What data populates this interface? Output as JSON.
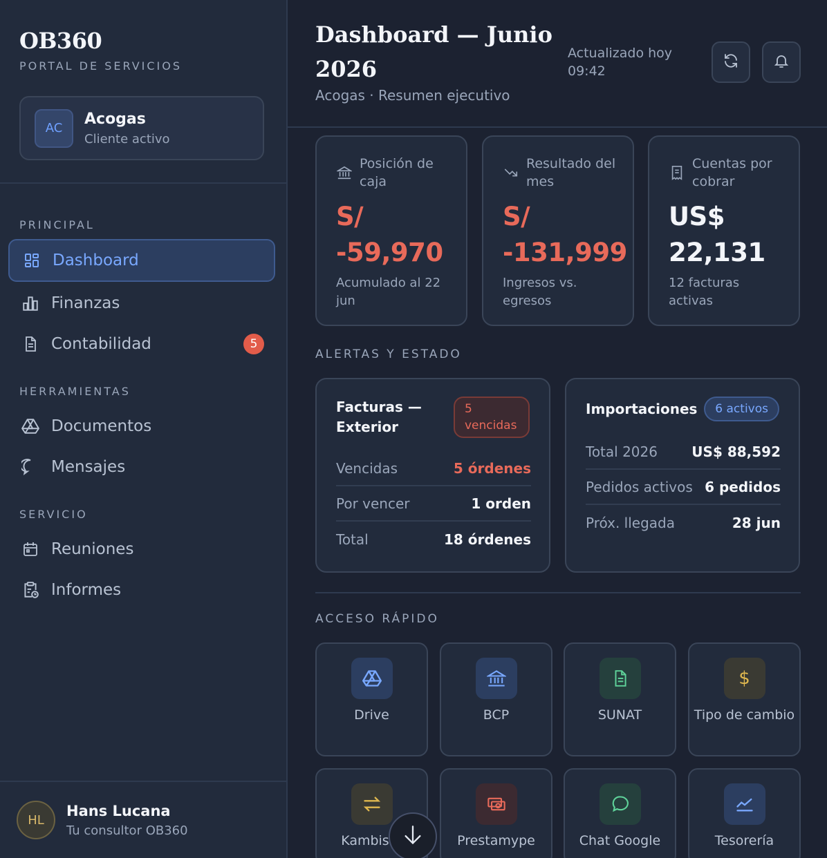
{
  "brand": {
    "title": "OB360",
    "subtitle": "PORTAL DE SERVICIOS"
  },
  "client": {
    "initials": "AC",
    "name": "Acogas",
    "status": "Cliente activo"
  },
  "nav": {
    "principal_label": "PRINCIPAL",
    "herramientas_label": "HERRAMIENTAS",
    "servicio_label": "SERVICIO",
    "items": [
      {
        "label": "Dashboard",
        "icon": "dashboard-icon"
      },
      {
        "label": "Finanzas",
        "icon": "bar-chart-icon"
      },
      {
        "label": "Contabilidad",
        "icon": "document-icon",
        "badge": "5"
      },
      {
        "label": "Documentos",
        "icon": "drive-icon"
      },
      {
        "label": "Mensajes",
        "icon": "chat-icon"
      },
      {
        "label": "Reuniones",
        "icon": "calendar-icon"
      },
      {
        "label": "Informes",
        "icon": "report-icon"
      }
    ]
  },
  "user": {
    "initials": "HL",
    "name": "Hans Lucana",
    "role": "Tu consultor OB360"
  },
  "header": {
    "title": "Dashboard — Junio 2026",
    "subtitle": "Acogas · Resumen ejecutivo",
    "updated": "Actualizado hoy 09:42"
  },
  "kpis": [
    {
      "label": "Posición de caja",
      "value": "S/ -59,970",
      "note": "Acumulado al 22 jun",
      "icon": "bank-icon"
    },
    {
      "label": "Resultado del mes",
      "value": "S/ -131,999",
      "note": "Ingresos vs. egresos",
      "icon": "trend-down-icon"
    },
    {
      "label": "Cuentas por cobrar",
      "value": "US$ 22,131",
      "note": "12 facturas activas",
      "icon": "receipt-icon"
    }
  ],
  "alerts_label": "ALERTAS Y ESTADO",
  "facturas": {
    "title": "Facturas — Exterior",
    "pill": "5 vencidas",
    "rows": [
      {
        "label": "Vencidas",
        "value": "5 órdenes"
      },
      {
        "label": "Por vencer",
        "value": "1 orden"
      },
      {
        "label": "Total",
        "value": "18 órdenes"
      }
    ]
  },
  "importaciones": {
    "title": "Importaciones",
    "pill": "6 activos",
    "rows": [
      {
        "label": "Total 2026",
        "value": "US$ 88,592"
      },
      {
        "label": "Pedidos activos",
        "value": "6 pedidos"
      },
      {
        "label": "Próx. llegada",
        "value": "28 jun"
      }
    ]
  },
  "quick_label": "ACCESO RÁPIDO",
  "quick": [
    {
      "label": "Drive",
      "icon": "drive-icon"
    },
    {
      "label": "BCP",
      "icon": "bank-icon"
    },
    {
      "label": "SUNAT",
      "icon": "document-icon"
    },
    {
      "label": "Tipo de cambio",
      "icon": "dollar-icon"
    },
    {
      "label": "Kambista",
      "icon": "exchange-icon"
    },
    {
      "label": "Prestamype",
      "icon": "money-icon"
    },
    {
      "label": "Chat Google",
      "icon": "chat-icon"
    },
    {
      "label": "Tesorería",
      "icon": "trend-up-icon"
    }
  ],
  "colors": {
    "accent": "#79a8ff",
    "danger": "#e86a5a",
    "background": "#1c2231",
    "sidebar": "#222b3c"
  }
}
